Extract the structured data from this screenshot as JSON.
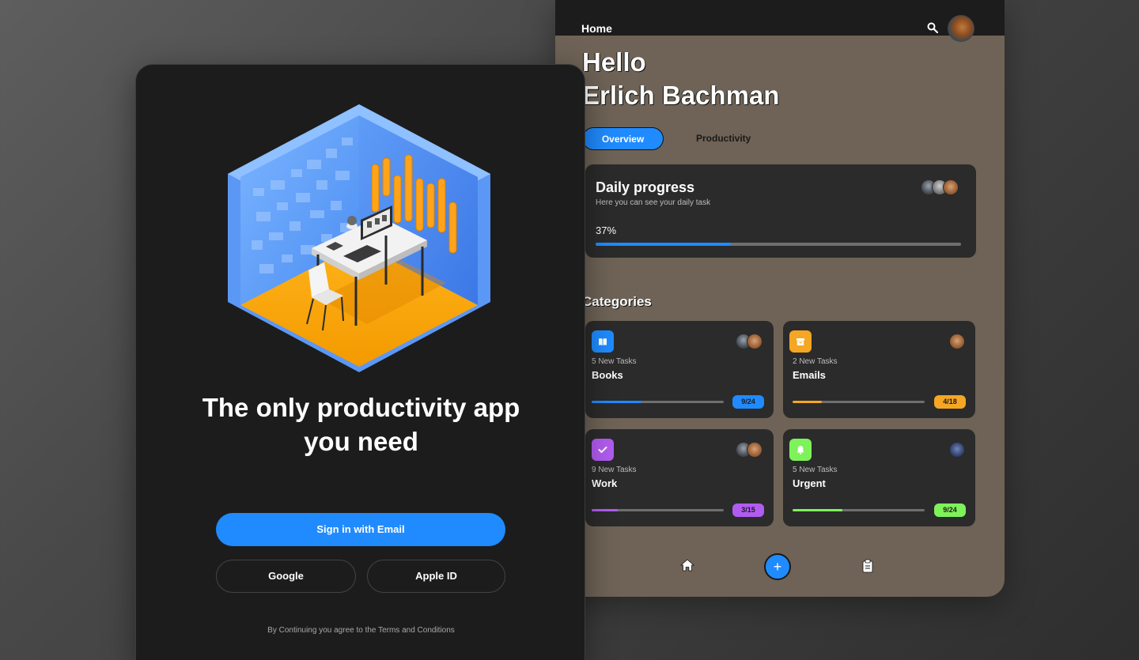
{
  "dashboard": {
    "header": {
      "home_label": "Home"
    },
    "greeting_line1": "Hello",
    "greeting_line2": "Erlich Bachman",
    "tabs": [
      {
        "label": "Overview",
        "active": true
      },
      {
        "label": "Productivity",
        "active": false
      }
    ],
    "daily_progress": {
      "title": "Daily progress",
      "subtitle": "Here you can see your daily task",
      "percent_label": "37%",
      "progress": 0.37
    },
    "categories_title": "Categories",
    "categories": [
      {
        "count": "5 New Tasks",
        "name": "Books",
        "badge": "9/24",
        "progress": 0.375,
        "color": "#1f8bff",
        "icon": "book-icon"
      },
      {
        "count": "2 New Tasks",
        "name": "Emails",
        "badge": "4/18",
        "progress": 0.22,
        "color": "#f5a623",
        "icon": "archive-icon"
      },
      {
        "count": "9 New Tasks",
        "name": "Work",
        "badge": "3/15",
        "progress": 0.2,
        "color": "#b15cf0",
        "icon": "check-icon"
      },
      {
        "count": "5 New Tasks",
        "name": "Urgent",
        "badge": "9/24",
        "progress": 0.375,
        "color": "#7ef25a",
        "icon": "bell-icon"
      }
    ],
    "bottom_nav": {
      "add_symbol": "+"
    }
  },
  "signin": {
    "headline_line1": "The only productivity app",
    "headline_line2": "you need",
    "email_button": "Sign in with Email",
    "google_button": "Google",
    "apple_button": "Apple ID",
    "terms": "By Continuing you agree to the Terms and Conditions"
  },
  "colors": {
    "accent": "#1f8bff",
    "dash_bg": "#6e6356",
    "card_bg": "#2b2b2b",
    "panel_bg": "#1c1c1c"
  }
}
